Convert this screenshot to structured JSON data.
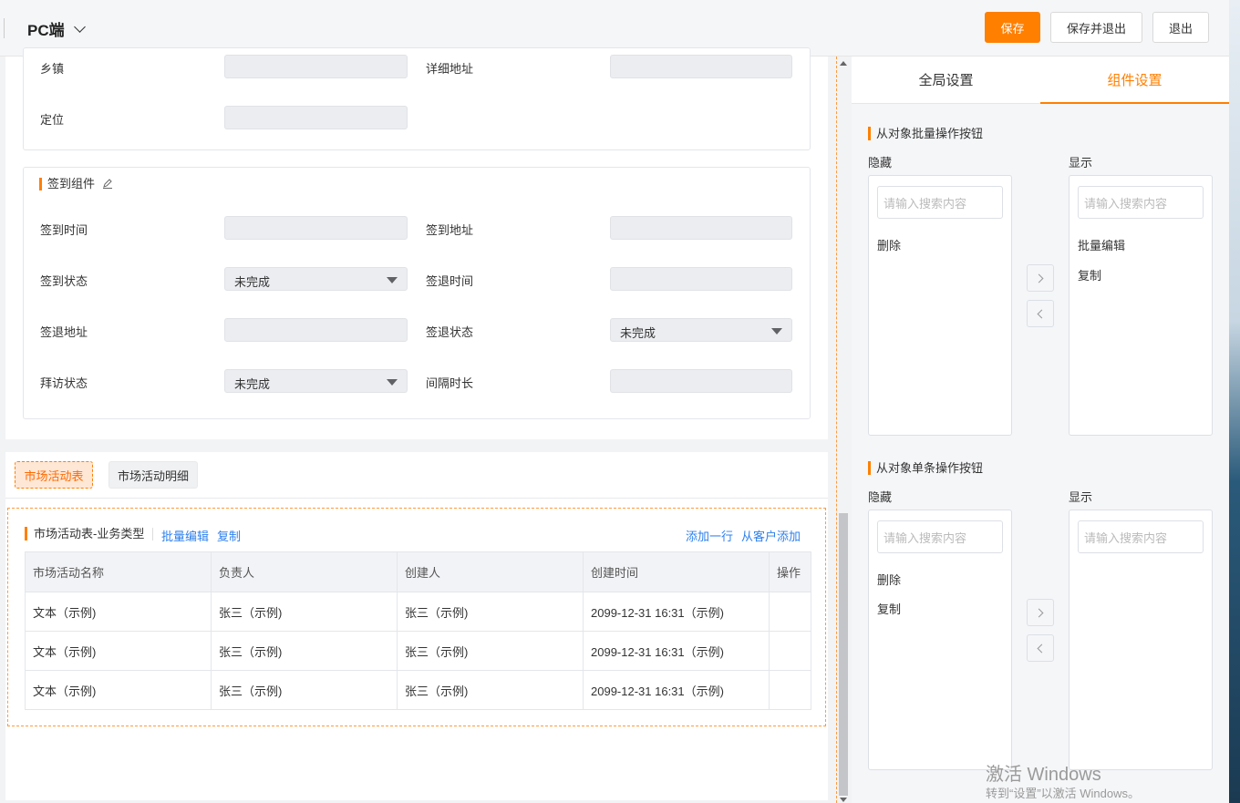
{
  "header": {
    "title": "PC端",
    "save": "保存",
    "save_exit": "保存并退出",
    "exit": "退出"
  },
  "address_card": {
    "town_label": "乡镇",
    "detail_label": "详细地址",
    "location_label": "定位"
  },
  "checkin_card": {
    "title": "签到组件",
    "checkin_time": "签到时间",
    "checkin_addr": "签到地址",
    "checkin_status": "签到状态",
    "checkin_status_value": "未完成",
    "checkout_time": "签退时间",
    "checkout_addr": "签退地址",
    "checkout_status": "签退状态",
    "checkout_status_value": "未完成",
    "visit_status": "拜访状态",
    "visit_status_value": "未完成",
    "interval": "间隔时长"
  },
  "tabs": [
    "市场活动表",
    "市场活动明细"
  ],
  "table_section": {
    "title": "市场活动表-业务类型",
    "batch_edit": "批量编辑",
    "copy": "复制",
    "add_row": "添加一行",
    "add_from_customer": "从客户添加",
    "columns": [
      "市场活动名称",
      "负责人",
      "创建人",
      "创建时间",
      "操作"
    ],
    "rows": [
      [
        "文本（示例)",
        "张三（示例)",
        "张三（示例)",
        "2099-12-31 16:31（示例)",
        ""
      ],
      [
        "文本（示例)",
        "张三（示例)",
        "张三（示例)",
        "2099-12-31 16:31（示例)",
        ""
      ],
      [
        "文本（示例)",
        "张三（示例)",
        "张三（示例)",
        "2099-12-31 16:31（示例)",
        ""
      ]
    ]
  },
  "right_panel": {
    "tab_global": "全局设置",
    "tab_component": "组件设置",
    "batch_section": {
      "title": "从对象批量操作按钮",
      "hidden_label": "隐藏",
      "shown_label": "显示",
      "search_placeholder": "请输入搜索内容",
      "hidden_items": [
        "删除"
      ],
      "shown_items": [
        "批量编辑",
        "复制"
      ]
    },
    "single_section": {
      "title": "从对象单条操作按钮",
      "hidden_label": "隐藏",
      "shown_label": "显示",
      "search_placeholder": "请输入搜索内容",
      "hidden_items": [
        "删除",
        "复制"
      ],
      "shown_items": []
    }
  },
  "watermark": {
    "line1": "激活 Windows",
    "line2": "转到“设置”以激活 Windows。"
  }
}
